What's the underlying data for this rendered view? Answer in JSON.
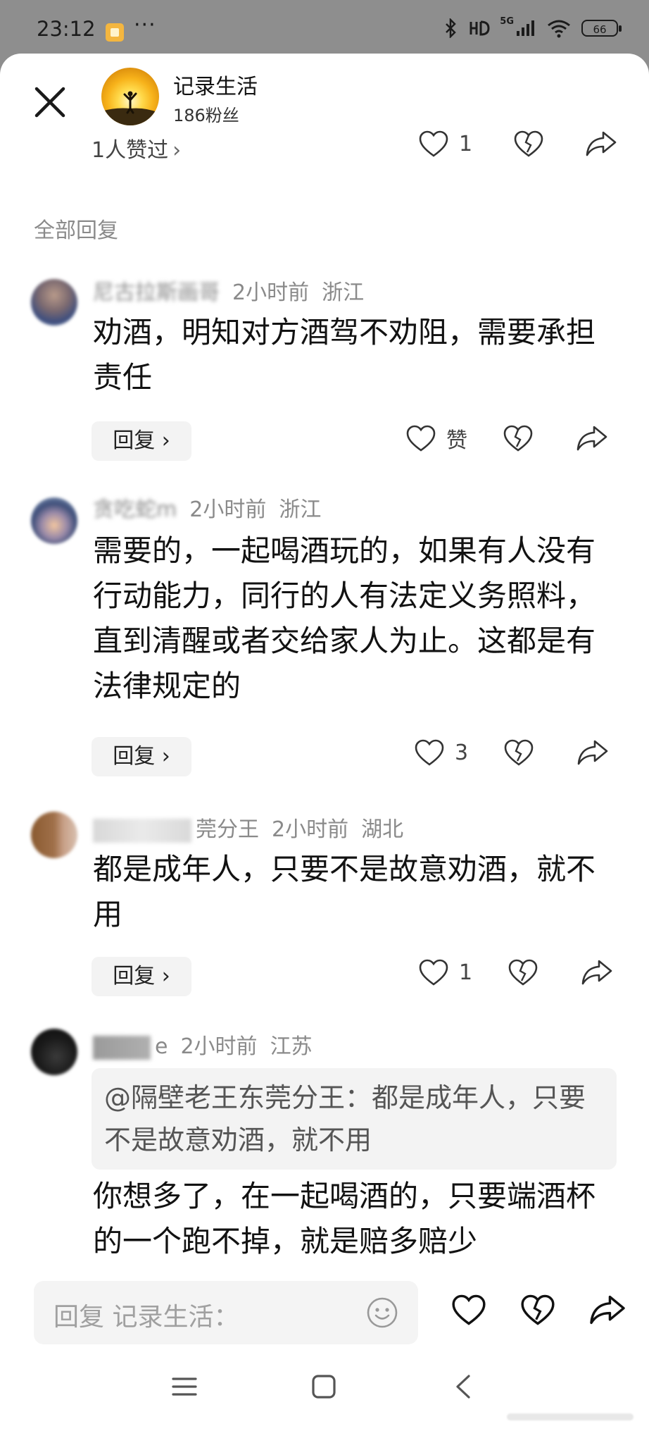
{
  "status_bar": {
    "time": "23:12",
    "more": "···",
    "network": "5G",
    "battery": "66"
  },
  "header": {
    "author_name": "记录生活",
    "fans": "186粉丝",
    "likes_summary": "1人赞过",
    "like_count": "1"
  },
  "section_label": "全部回复",
  "comments": [
    {
      "name": "尼古拉斯画哥",
      "time": "2小时前",
      "location": "浙江",
      "text": "劝酒，明知对方酒驾不劝阻，需要承担责任",
      "reply_label": "回复",
      "like_label": "赞"
    },
    {
      "name": "贪吃蛇m",
      "time": "2小时前",
      "location": "浙江",
      "text": "需要的，一起喝酒玩的，如果有人没有行动能力，同行的人有法定义务照料，直到清醒或者交给家人为止。这都是有法律规定的",
      "reply_label": "回复",
      "like_count": "3"
    },
    {
      "name": "莞分王",
      "time": "2小时前",
      "location": "湖北",
      "text": "都是成年人，只要不是故意劝酒，就不用",
      "reply_label": "回复",
      "like_count": "1"
    },
    {
      "name": "e",
      "time": "2小时前",
      "location": "江苏",
      "quote": "@隔壁老王东莞分王：都是成年人，只要不是故意劝酒，就不用",
      "text": "你想多了，在一起喝酒的，只要端酒杯的一个跑不掉，就是赔多赔少"
    }
  ],
  "input": {
    "placeholder": "回复 记录生活："
  },
  "colors": {
    "sheet_bg": "#ffffff",
    "backdrop": "#8e8e8e",
    "meta_gray": "#8a8a8a",
    "chip_bg": "#f3f3f3"
  }
}
